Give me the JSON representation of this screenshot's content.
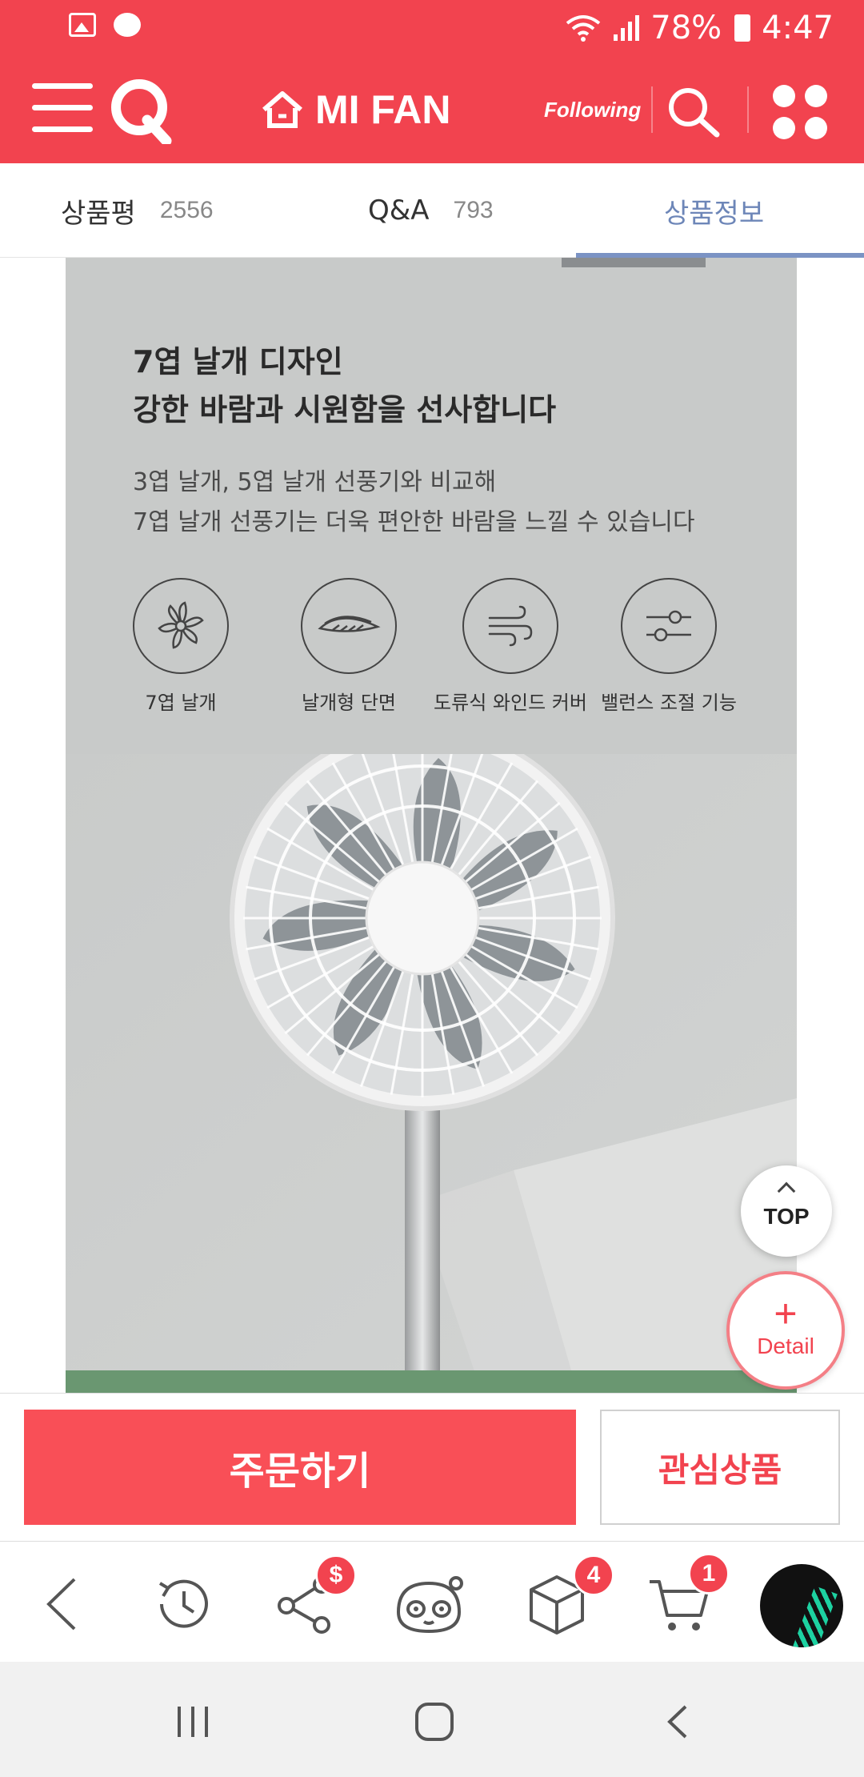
{
  "status_bar": {
    "battery_percent": "78%",
    "time": "4:47"
  },
  "header": {
    "brand": "MI FAN",
    "following_label": "Following"
  },
  "tabs": [
    {
      "label": "상품평",
      "count": "2556"
    },
    {
      "label": "Q&A",
      "count": "793"
    },
    {
      "label": "상품정보",
      "count": ""
    }
  ],
  "active_tab": "상품정보",
  "product_image": {
    "headline_line1": "7엽 날개 디자인",
    "headline_line2": "강한 바람과 시원함을 선사합니다",
    "sub_line1": "3엽 날개, 5엽 날개 선풍기와 비교해",
    "sub_line2": "7엽 날개 선풍기는 더욱 편안한 바람을 느낄 수 있습니다",
    "features": [
      {
        "icon": "fan-blade-icon",
        "label": "7엽 날개"
      },
      {
        "icon": "wing-section-icon",
        "label": "날개형 단면"
      },
      {
        "icon": "wind-icon",
        "label": "도류식 와인드 커버"
      },
      {
        "icon": "balance-slider-icon",
        "label": "밸런스 조절 기능"
      }
    ]
  },
  "floating": {
    "top_label": "TOP",
    "detail_label": "Detail"
  },
  "action_bar": {
    "order_label": "주문하기",
    "wishlist_label": "관심상품"
  },
  "toolbar": {
    "share_badge": "$",
    "box_badge": "4",
    "cart_badge": "1"
  },
  "colors": {
    "brand_red": "#f2434f",
    "order_red": "#f94f57",
    "active_tab_blue": "#7b93c4"
  }
}
